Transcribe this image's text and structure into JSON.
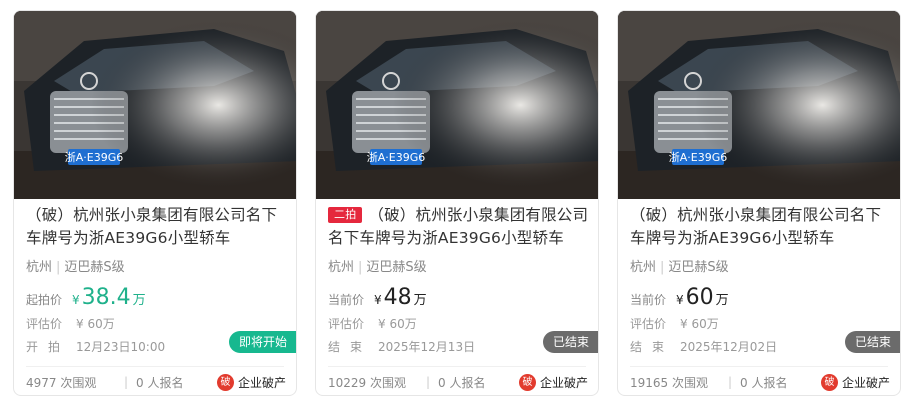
{
  "cards": [
    {
      "title": "（破）杭州张小泉集团有限公司名下车牌号为浙AE39G6小型轿车",
      "round_tag": "",
      "location": "杭州",
      "model": "迈巴赫S级",
      "price_label": "起拍价",
      "price_yen": "¥",
      "price_value": "38.4",
      "price_unit": "万",
      "eval_label": "评估价",
      "eval_value": "¥ 60万",
      "date_label": "开拍",
      "date_value": "12月23日10:00",
      "status": "即将开始",
      "views": "4977 次围观",
      "signups": "0 人报名",
      "category_icon": "破",
      "category": "企业破产",
      "plate": "浙A·E39G6"
    },
    {
      "title": "（破）杭州张小泉集团有限公司名下车牌号为浙AE39G6小型轿车",
      "round_tag": "二拍",
      "location": "杭州",
      "model": "迈巴赫S级",
      "price_label": "当前价",
      "price_yen": "¥",
      "price_value": "48",
      "price_unit": "万",
      "eval_label": "评估价",
      "eval_value": "¥ 60万",
      "date_label": "结束",
      "date_value": "2025年12月13日",
      "status": "已结束",
      "views": "10229 次围观",
      "signups": "0 人报名",
      "category_icon": "破",
      "category": "企业破产",
      "plate": "浙A·E39G6"
    },
    {
      "title": "（破）杭州张小泉集团有限公司名下车牌号为浙AE39G6小型轿车",
      "round_tag": "",
      "location": "杭州",
      "model": "迈巴赫S级",
      "price_label": "当前价",
      "price_yen": "¥",
      "price_value": "60",
      "price_unit": "万",
      "eval_label": "评估价",
      "eval_value": "¥ 60万",
      "date_label": "结束",
      "date_value": "2025年12月02日",
      "status": "已结束",
      "views": "19165 次围观",
      "signups": "0 人报名",
      "category_icon": "破",
      "category": "企业破产",
      "plate": "浙A·E39G6"
    }
  ],
  "colors": {
    "price_green": "#1fb18b",
    "badge_start": "#17b88f",
    "badge_end": "#6b6b6b",
    "round_tag": "#e5283d",
    "category_icon": "#e23b2e"
  }
}
